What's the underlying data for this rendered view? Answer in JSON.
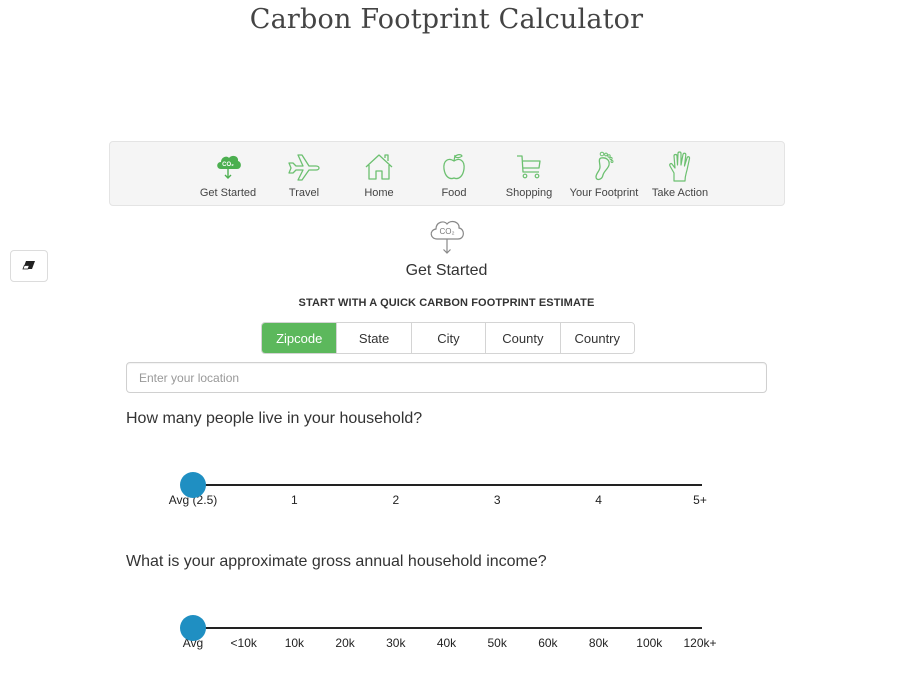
{
  "page": {
    "title": "Carbon Footprint Calculator"
  },
  "nav": {
    "items": [
      {
        "label": "Get Started",
        "icon": "co2-cloud-icon",
        "active": true
      },
      {
        "label": "Travel",
        "icon": "airplane-icon",
        "active": false
      },
      {
        "label": "Home",
        "icon": "house-icon",
        "active": false
      },
      {
        "label": "Food",
        "icon": "apple-icon",
        "active": false
      },
      {
        "label": "Shopping",
        "icon": "shopping-cart-icon",
        "active": false
      },
      {
        "label": "Your Footprint",
        "icon": "footprint-icon",
        "active": false
      },
      {
        "label": "Take Action",
        "icon": "hand-icon",
        "active": false
      }
    ]
  },
  "toolbar": {
    "eraser_icon": "eraser-icon"
  },
  "section": {
    "icon": "co2-cloud-icon",
    "title": "Get Started",
    "estimate_heading": "START WITH A QUICK CARBON FOOTPRINT ESTIMATE"
  },
  "location_type": {
    "options": [
      "Zipcode",
      "State",
      "City",
      "County",
      "Country"
    ],
    "selected": "Zipcode"
  },
  "location_input": {
    "value": "",
    "placeholder": "Enter your location"
  },
  "household": {
    "question": "How many people live in your household?",
    "ticks": [
      "Avg (2.5)",
      "1",
      "2",
      "3",
      "4",
      "5+"
    ],
    "selected_index": 0
  },
  "income": {
    "question": "What is your approximate gross annual household income?",
    "ticks": [
      "Avg",
      "<10k",
      "10k",
      "20k",
      "30k",
      "40k",
      "50k",
      "60k",
      "80k",
      "100k",
      "120k+"
    ],
    "selected_index": 0
  },
  "colors": {
    "brand_green": "#5cb85c",
    "icon_green": "#6cc070",
    "slider_blue": "#1f8fc2"
  }
}
